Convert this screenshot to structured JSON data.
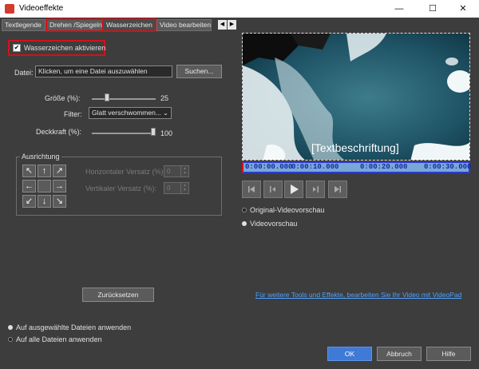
{
  "window": {
    "title": "Videoeffekte",
    "minimize": "—",
    "maximize": "☐",
    "close": "✕"
  },
  "tabs": [
    "Textlegende",
    "Drehen /Spiegeln",
    "Wasserzeichen",
    "Video bearbeiten"
  ],
  "tab_arrows": [
    "◀",
    "▶"
  ],
  "watermark": {
    "enable_label": "Wasserzeichen aktivieren",
    "enabled_mark": "✔",
    "file_label": "Datei:",
    "file_value": "Klicken, um eine Datei auszuwählen",
    "browse_button": "Suchen...",
    "size_label": "Größe (%):",
    "size_value": "25",
    "filter_label": "Filter:",
    "filter_value": "Glatt verschwommen...",
    "opacity_label": "Deckkraft (%):",
    "opacity_value": "100"
  },
  "alignment": {
    "group_label": "Ausrichtung",
    "arrows": [
      "↖",
      "↑",
      "↗",
      "←",
      "",
      "→",
      "↙",
      "↓",
      "↘"
    ],
    "h_offset_label": "Horizontaler Versatz (%):",
    "h_offset_value": "0",
    "v_offset_label": "Vertikaler Versatz (%):",
    "v_offset_value": "0"
  },
  "reset_button": "Zurücksetzen",
  "preview": {
    "caption": "[Textbeschriftung]",
    "timeline": [
      "0:00:00.000",
      "0:00:10.000",
      "0:00:20.000",
      "0:00:30.000"
    ],
    "original_preview_label": "Original-Videovorschau",
    "video_preview_label": "Videovorschau",
    "videopad_link": "Für weitere Tools und Effekte, bearbeiten Sie Ihr Video mit VideoPad"
  },
  "apply": {
    "selected_files": "Auf ausgewählte Dateien anwenden",
    "all_files": "Auf alle Dateien anwenden"
  },
  "buttons": {
    "ok": "OK",
    "cancel": "Abbruch",
    "help": "Hilfe"
  },
  "colors": {
    "highlight": "#d0121a",
    "link": "#4ea1ff",
    "ok": "#3f7ad6"
  }
}
